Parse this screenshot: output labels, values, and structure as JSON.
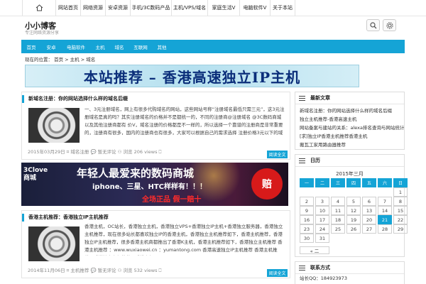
{
  "topnav": {
    "home_icon": "home-icon",
    "items": [
      "网站首页",
      "网络资源",
      "安卓资源",
      "手机/3C数码产品",
      "主机/VPS/域名",
      "家庭生活V",
      "电脑软件V",
      "关于本站"
    ]
  },
  "header": {
    "title": "小小博客",
    "subtitle": "专注网络资源分享",
    "search_icon": "search-icon",
    "settings_icon": "gear-icon"
  },
  "catnav": {
    "items": [
      "首页",
      "安卓",
      "电脑软件",
      "主机",
      "域名",
      "互联网",
      "其他"
    ]
  },
  "breadcrumb": "现在的位置： 首页 > 主机 > 域名",
  "banner1": {
    "text": "本站推荐 – 香港高速独立IP主机"
  },
  "banner2": {
    "brand_line1": "3Clove",
    "brand_line2": "商城",
    "headline": "年轻人最爱来的数码商城",
    "subline": "iphone、三星、HTC样样有！！！",
    "red_text": "全场正品  假一赔十",
    "seal_text": "赔"
  },
  "posts": [
    {
      "title": "新域名注册：你的网站选择什么样的域名后缀",
      "excerpt": "一、3元注册域名，网上有很多代购域名的网站，这些网站号称“注册域名最低只需三元”，这3元注册域名是真的吗？其实注册域名的价格并不是都统一的，不同的注册商@注册域名 @3C数码商城 以及其他注册商都有 价V，域名注册的价格都是不一样的，所以选择一个靠谱的注册商是非常重要的，注册商有很多，国内的注册商也有很多，大家可以根据自己的需求选择 注册价格3元以下的域名注册商都是不靠谱的，大家一定要小心谨慎…",
      "meta": "2015年03月29日 ⌗ 域名注册 💬 暂无评论 ⚇ 浏览 206 views ⎕",
      "more": "阅读全文"
    },
    {
      "title": "香港主机推荐：香港独立IP主机推荐",
      "excerpt": "香港主机，OC站长，香港独立主机，香港独立VPS+香港独立IP主机+香港独立服务器，香港独立主机推荐，现在很多站长都喜欢独立IP的香港主机，香港独立主机推荐如下，香港主机推荐，香港独立IP主机推荐，很多香港主机商都推出了香港K主机，香港主机推荐如下，香港独立主机推荐 香港主机推荐 ：www.wuxiaowei.cn ：yumantong.com 香港高速独立IP主机推荐 香港主机推荐，香港独立主机推荐，香港主机…",
      "meta": "2014年11月06日 ⌗ 主机推荐 💬 暂无评论 ⚇ 浏览 532 views ⎕",
      "more": "阅读全文"
    }
  ],
  "sidebar": {
    "latest": {
      "title": "最新文章",
      "items": [
        "新域名注册：你的网站选择什么样的域名后缀",
        "独立主机推荐-香港高速主机",
        "网站备案与建站的关系：alexa排名查询与网站统计",
        "[求]独立IP香港主机推荐香港主机",
        "搬瓦工家用路由器推荐"
      ]
    },
    "calendar": {
      "title": "日历",
      "month": "2015年三月",
      "weekdays": [
        "一",
        "二",
        "三",
        "四",
        "五",
        "六",
        "日"
      ],
      "leading_blanks": 6,
      "days": 31,
      "today": 21,
      "prev": "« 二"
    },
    "contact": {
      "title": "联系方式",
      "qq": "站长QQ：184923973"
    }
  },
  "colors": {
    "accent": "#15a4d6",
    "border": "#e3e3e3"
  }
}
